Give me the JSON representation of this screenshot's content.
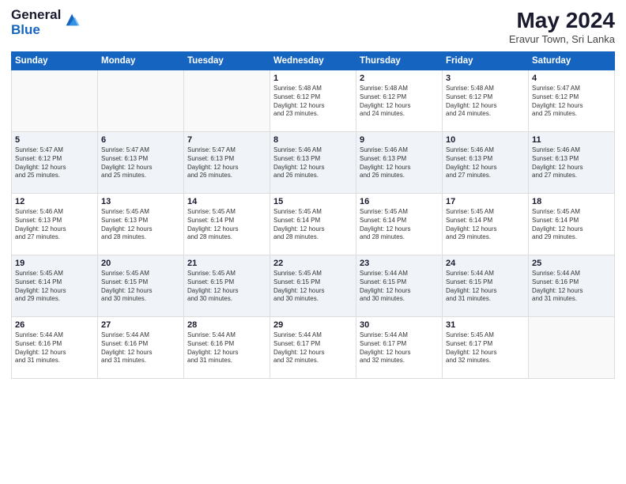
{
  "header": {
    "logo_general": "General",
    "logo_blue": "Blue",
    "month_title": "May 2024",
    "location": "Eravur Town, Sri Lanka"
  },
  "weekdays": [
    "Sunday",
    "Monday",
    "Tuesday",
    "Wednesday",
    "Thursday",
    "Friday",
    "Saturday"
  ],
  "weeks": [
    [
      {
        "day": "",
        "info": ""
      },
      {
        "day": "",
        "info": ""
      },
      {
        "day": "",
        "info": ""
      },
      {
        "day": "1",
        "info": "Sunrise: 5:48 AM\nSunset: 6:12 PM\nDaylight: 12 hours\nand 23 minutes."
      },
      {
        "day": "2",
        "info": "Sunrise: 5:48 AM\nSunset: 6:12 PM\nDaylight: 12 hours\nand 24 minutes."
      },
      {
        "day": "3",
        "info": "Sunrise: 5:48 AM\nSunset: 6:12 PM\nDaylight: 12 hours\nand 24 minutes."
      },
      {
        "day": "4",
        "info": "Sunrise: 5:47 AM\nSunset: 6:12 PM\nDaylight: 12 hours\nand 25 minutes."
      }
    ],
    [
      {
        "day": "5",
        "info": "Sunrise: 5:47 AM\nSunset: 6:12 PM\nDaylight: 12 hours\nand 25 minutes."
      },
      {
        "day": "6",
        "info": "Sunrise: 5:47 AM\nSunset: 6:13 PM\nDaylight: 12 hours\nand 25 minutes."
      },
      {
        "day": "7",
        "info": "Sunrise: 5:47 AM\nSunset: 6:13 PM\nDaylight: 12 hours\nand 26 minutes."
      },
      {
        "day": "8",
        "info": "Sunrise: 5:46 AM\nSunset: 6:13 PM\nDaylight: 12 hours\nand 26 minutes."
      },
      {
        "day": "9",
        "info": "Sunrise: 5:46 AM\nSunset: 6:13 PM\nDaylight: 12 hours\nand 26 minutes."
      },
      {
        "day": "10",
        "info": "Sunrise: 5:46 AM\nSunset: 6:13 PM\nDaylight: 12 hours\nand 27 minutes."
      },
      {
        "day": "11",
        "info": "Sunrise: 5:46 AM\nSunset: 6:13 PM\nDaylight: 12 hours\nand 27 minutes."
      }
    ],
    [
      {
        "day": "12",
        "info": "Sunrise: 5:46 AM\nSunset: 6:13 PM\nDaylight: 12 hours\nand 27 minutes."
      },
      {
        "day": "13",
        "info": "Sunrise: 5:45 AM\nSunset: 6:13 PM\nDaylight: 12 hours\nand 28 minutes."
      },
      {
        "day": "14",
        "info": "Sunrise: 5:45 AM\nSunset: 6:14 PM\nDaylight: 12 hours\nand 28 minutes."
      },
      {
        "day": "15",
        "info": "Sunrise: 5:45 AM\nSunset: 6:14 PM\nDaylight: 12 hours\nand 28 minutes."
      },
      {
        "day": "16",
        "info": "Sunrise: 5:45 AM\nSunset: 6:14 PM\nDaylight: 12 hours\nand 28 minutes."
      },
      {
        "day": "17",
        "info": "Sunrise: 5:45 AM\nSunset: 6:14 PM\nDaylight: 12 hours\nand 29 minutes."
      },
      {
        "day": "18",
        "info": "Sunrise: 5:45 AM\nSunset: 6:14 PM\nDaylight: 12 hours\nand 29 minutes."
      }
    ],
    [
      {
        "day": "19",
        "info": "Sunrise: 5:45 AM\nSunset: 6:14 PM\nDaylight: 12 hours\nand 29 minutes."
      },
      {
        "day": "20",
        "info": "Sunrise: 5:45 AM\nSunset: 6:15 PM\nDaylight: 12 hours\nand 30 minutes."
      },
      {
        "day": "21",
        "info": "Sunrise: 5:45 AM\nSunset: 6:15 PM\nDaylight: 12 hours\nand 30 minutes."
      },
      {
        "day": "22",
        "info": "Sunrise: 5:45 AM\nSunset: 6:15 PM\nDaylight: 12 hours\nand 30 minutes."
      },
      {
        "day": "23",
        "info": "Sunrise: 5:44 AM\nSunset: 6:15 PM\nDaylight: 12 hours\nand 30 minutes."
      },
      {
        "day": "24",
        "info": "Sunrise: 5:44 AM\nSunset: 6:15 PM\nDaylight: 12 hours\nand 31 minutes."
      },
      {
        "day": "25",
        "info": "Sunrise: 5:44 AM\nSunset: 6:16 PM\nDaylight: 12 hours\nand 31 minutes."
      }
    ],
    [
      {
        "day": "26",
        "info": "Sunrise: 5:44 AM\nSunset: 6:16 PM\nDaylight: 12 hours\nand 31 minutes."
      },
      {
        "day": "27",
        "info": "Sunrise: 5:44 AM\nSunset: 6:16 PM\nDaylight: 12 hours\nand 31 minutes."
      },
      {
        "day": "28",
        "info": "Sunrise: 5:44 AM\nSunset: 6:16 PM\nDaylight: 12 hours\nand 31 minutes."
      },
      {
        "day": "29",
        "info": "Sunrise: 5:44 AM\nSunset: 6:17 PM\nDaylight: 12 hours\nand 32 minutes."
      },
      {
        "day": "30",
        "info": "Sunrise: 5:44 AM\nSunset: 6:17 PM\nDaylight: 12 hours\nand 32 minutes."
      },
      {
        "day": "31",
        "info": "Sunrise: 5:45 AM\nSunset: 6:17 PM\nDaylight: 12 hours\nand 32 minutes."
      },
      {
        "day": "",
        "info": ""
      }
    ]
  ]
}
